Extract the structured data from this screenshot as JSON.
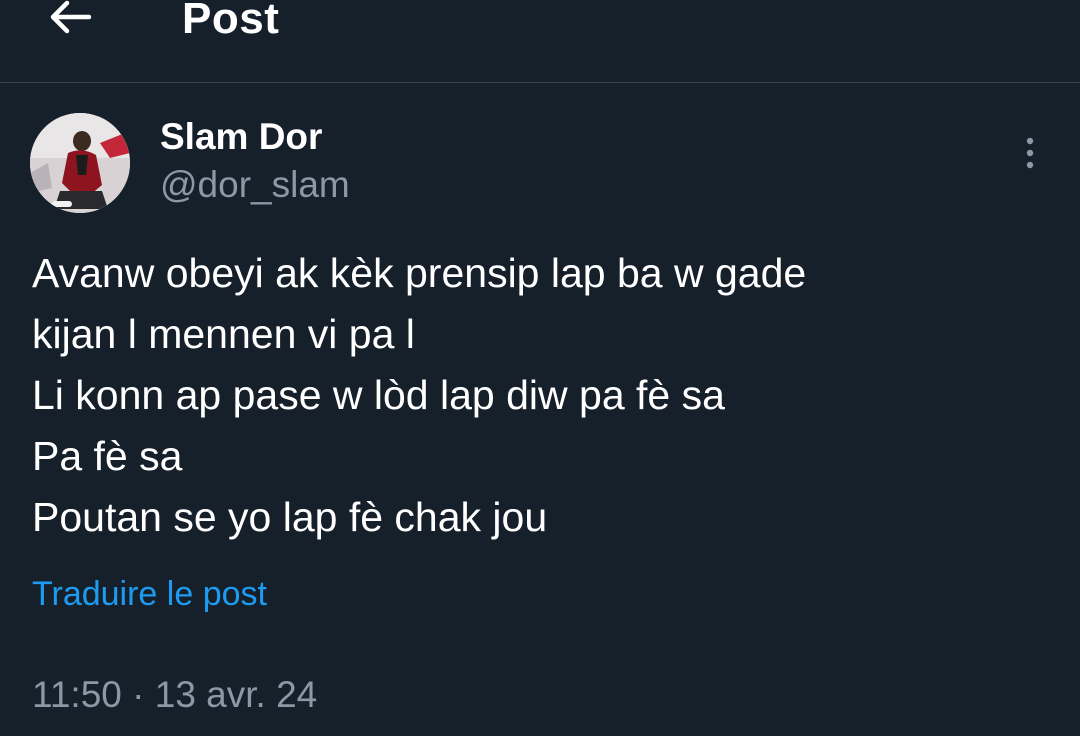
{
  "header": {
    "title": "Post",
    "back_icon": "arrow-left-icon"
  },
  "post": {
    "author": {
      "display_name": "Slam Dor",
      "handle": "@dor_slam"
    },
    "more_icon": "more-vertical-icon",
    "lines": [
      "Avanw obeyi ak kèk prensip lap ba w gade",
      "kijan l mennen vi pa l",
      "Li konn ap pase w lòd lap diw pa fè sa",
      "Pa fè sa",
      "Poutan se yo lap fè chak jou"
    ],
    "translate_label": "Traduire le post",
    "time": "11:50",
    "separator": "·",
    "date": "13 avr. 24"
  },
  "colors": {
    "background": "#15202b",
    "divider": "#38444d",
    "text": "#ffffff",
    "secondary_text": "#8b98a5",
    "link": "#1d9bf0"
  }
}
